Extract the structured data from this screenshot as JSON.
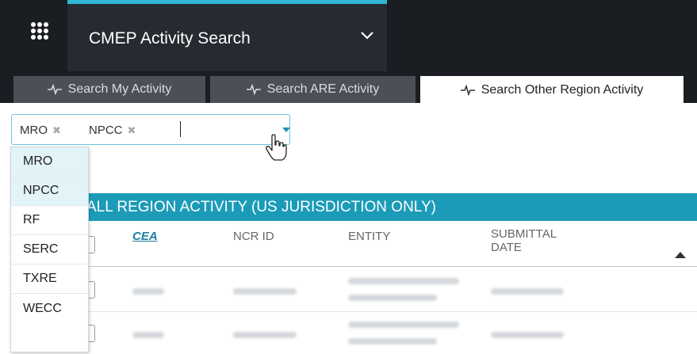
{
  "header": {
    "title": "CMEP Activity Search",
    "accent_color": "#2fb7d4"
  },
  "tabs": [
    {
      "label": "Search My Activity",
      "icon": "pulse-icon",
      "active": false
    },
    {
      "label": "Search ARE Activity",
      "icon": "pulse-icon",
      "active": false
    },
    {
      "label": "Search Other Region Activity",
      "icon": "pulse-icon",
      "active": true
    }
  ],
  "region_select": {
    "chips": [
      "MRO",
      "NPCC"
    ],
    "remove_glyph": "✖",
    "options": [
      "MRO",
      "NPCC",
      "RF",
      "SERC",
      "TXRE",
      "WECC"
    ]
  },
  "table": {
    "banner": "ALL REGION ACTIVITY (US JURISDICTION ONLY)",
    "columns": {
      "cea": "CEA",
      "ncr_id": "NCR ID",
      "entity": "ENTITY",
      "submittal_line1": "SUBMITTAL",
      "submittal_line2": "DATE"
    },
    "sort_column": "SUBMITTAL DATE",
    "sort_direction": "ascending"
  }
}
